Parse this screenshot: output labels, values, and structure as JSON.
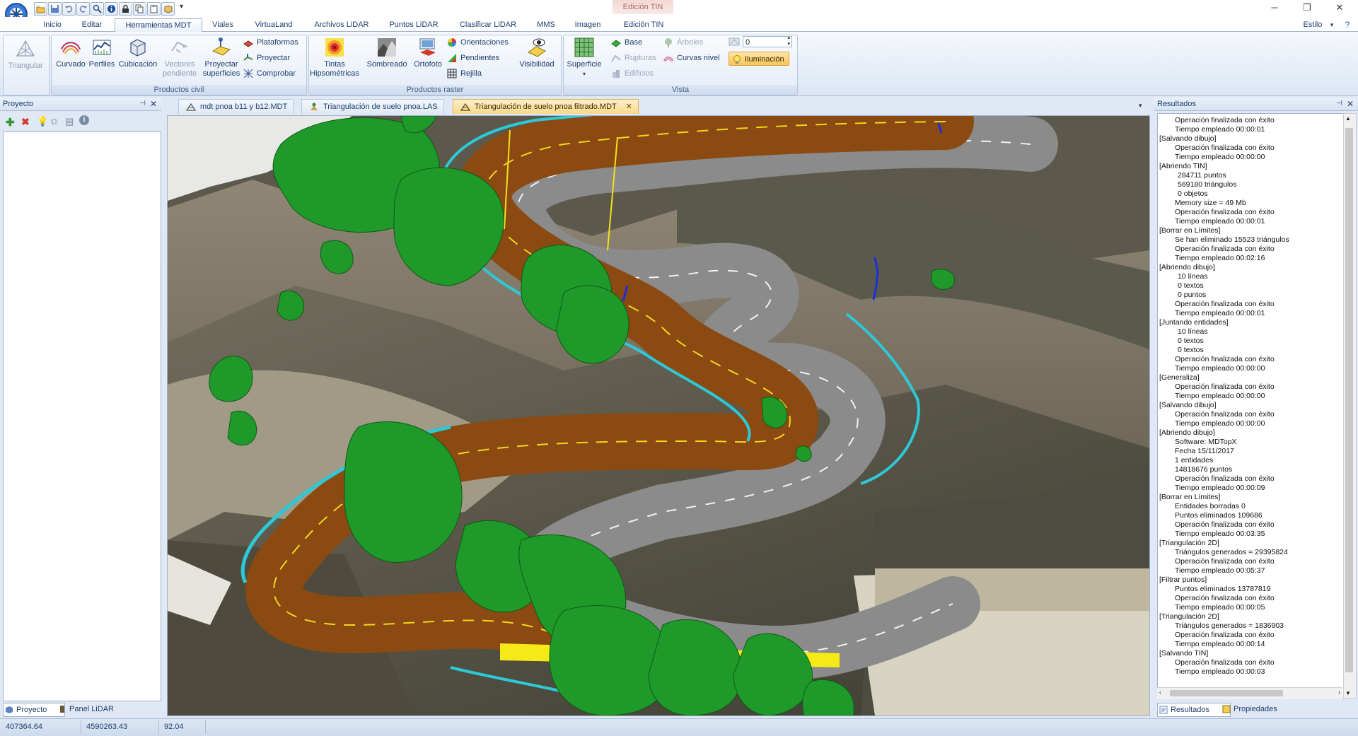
{
  "title_bar": {
    "context_tab_header": "Edición TIN",
    "window_controls": [
      "minimize",
      "restore",
      "close"
    ]
  },
  "ribbon": {
    "tabs": [
      {
        "label": "Inicio"
      },
      {
        "label": "Editar"
      },
      {
        "label": "Herramientas MDT",
        "active": true
      },
      {
        "label": "Viales"
      },
      {
        "label": "VirtuaLand"
      },
      {
        "label": "Archivos LiDAR"
      },
      {
        "label": "Puntos LiDAR"
      },
      {
        "label": "Clasificar LiDAR"
      },
      {
        "label": "MMS"
      },
      {
        "label": "Imagen"
      },
      {
        "label": "Edición TIN"
      }
    ],
    "style_label": "Estilo",
    "groups": {
      "triangular": {
        "button": "Triangular"
      },
      "productos_civil": {
        "label": "Productos civil",
        "buttons": [
          "Curvado",
          "Perfiles",
          "Cubicación",
          "Vectores pendiente",
          "Proyectar superficies"
        ],
        "small": [
          "Plataformas",
          "Proyectar",
          "Comprobar"
        ]
      },
      "productos_raster": {
        "label": "Productos raster",
        "buttons": [
          "Tintas Hipsométricas",
          "Sombreado",
          "Ortofoto",
          "Visibilidad"
        ],
        "small": [
          "Orientaciones",
          "Pendientes",
          "Rejilla"
        ]
      },
      "vista": {
        "label": "Vista",
        "superficie": "Superficie",
        "small": [
          "Base",
          "Rupturas",
          "Edificios",
          "Árboles",
          "Curvas nivel"
        ],
        "spin_value": "0",
        "iluminacion": "Iluminación"
      }
    }
  },
  "left_panel": {
    "title": "Proyecto",
    "bottom_tabs": [
      "Proyecto",
      "Panel LiDAR"
    ]
  },
  "documents": {
    "tabs": [
      {
        "label": "mdt pnoa b11 y b12.MDT"
      },
      {
        "label": "Triangulación de suelo pnoa.LAS"
      },
      {
        "label": "Triangulación de suelo pnoa filtrado.MDT",
        "active": true
      }
    ]
  },
  "results_panel": {
    "title": "Resultados",
    "bottom_tabs": [
      "Resultados",
      "Propiedades"
    ],
    "log": [
      {
        "t": "Operación finalizada con éxito",
        "lvl": 1
      },
      {
        "t": "Tiempo empleado 00:00:01",
        "lvl": 1
      },
      {
        "t": "[Salvando dibujo]",
        "lvl": 0
      },
      {
        "t": "Operación finalizada con éxito",
        "lvl": 1
      },
      {
        "t": "Tiempo empleado 00:00:00",
        "lvl": 1
      },
      {
        "t": "[Abriendo TIN]",
        "lvl": 0
      },
      {
        "t": "284711 puntos",
        "lvl": 2
      },
      {
        "t": "569180 triángulos",
        "lvl": 2
      },
      {
        "t": "0 objetos",
        "lvl": 2
      },
      {
        "t": "Memory size = 49 Mb",
        "lvl": 1
      },
      {
        "t": "Operación finalizada con éxito",
        "lvl": 1
      },
      {
        "t": "Tiempo empleado 00:00:01",
        "lvl": 1
      },
      {
        "t": "[Borrar en Límites]",
        "lvl": 0
      },
      {
        "t": "Se han eliminado 15523 triángulos",
        "lvl": 1
      },
      {
        "t": "Operación finalizada con éxito",
        "lvl": 1
      },
      {
        "t": "Tiempo empleado 00:02:16",
        "lvl": 1
      },
      {
        "t": "[Abriendo dibujo]",
        "lvl": 0
      },
      {
        "t": "10 líneas",
        "lvl": 2
      },
      {
        "t": "0 textos",
        "lvl": 2
      },
      {
        "t": "0 puntos",
        "lvl": 2
      },
      {
        "t": "Operación finalizada con éxito",
        "lvl": 1
      },
      {
        "t": "Tiempo empleado 00:00:01",
        "lvl": 1
      },
      {
        "t": "[Juntando entidades]",
        "lvl": 0
      },
      {
        "t": "10 líneas",
        "lvl": 2
      },
      {
        "t": "0 textos",
        "lvl": 2
      },
      {
        "t": "0 textos",
        "lvl": 2
      },
      {
        "t": "Operación finalizada con éxito",
        "lvl": 1
      },
      {
        "t": "Tiempo empleado 00:00:00",
        "lvl": 1
      },
      {
        "t": "[Generaliza]",
        "lvl": 0
      },
      {
        "t": "Operación finalizada con éxito",
        "lvl": 1
      },
      {
        "t": "Tiempo empleado 00:00:00",
        "lvl": 1
      },
      {
        "t": "[Salvando dibujo]",
        "lvl": 0
      },
      {
        "t": "Operación finalizada con éxito",
        "lvl": 1
      },
      {
        "t": "Tiempo empleado 00:00:00",
        "lvl": 1
      },
      {
        "t": "[Abriendo dibujo]",
        "lvl": 0
      },
      {
        "t": "Software: MDTopX",
        "lvl": 1
      },
      {
        "t": "Fecha 15/11/2017",
        "lvl": 1
      },
      {
        "t": "1 entidades",
        "lvl": 1
      },
      {
        "t": "14818676 puntos",
        "lvl": 1
      },
      {
        "t": "Operación finalizada con éxito",
        "lvl": 1
      },
      {
        "t": "Tiempo empleado 00:00:09",
        "lvl": 1
      },
      {
        "t": "[Borrar en Límites]",
        "lvl": 0
      },
      {
        "t": "Entidades borradas 0",
        "lvl": 1
      },
      {
        "t": "Puntos eliminados 109686",
        "lvl": 1
      },
      {
        "t": "Operación finalizada con éxito",
        "lvl": 1
      },
      {
        "t": "Tiempo empleado 00:03:35",
        "lvl": 1
      },
      {
        "t": "[Triangulación 2D]",
        "lvl": 0
      },
      {
        "t": "Triángulos generados = 29395824",
        "lvl": 1
      },
      {
        "t": "Operación finalizada con éxito",
        "lvl": 1
      },
      {
        "t": "Tiempo empleado 00:05:37",
        "lvl": 1
      },
      {
        "t": "[Filtrar puntos]",
        "lvl": 0
      },
      {
        "t": "Puntos eliminados 13787819",
        "lvl": 1
      },
      {
        "t": "Operación finalizada con éxito",
        "lvl": 1
      },
      {
        "t": "Tiempo empleado 00:00:05",
        "lvl": 1
      },
      {
        "t": "[Triangulación 2D]",
        "lvl": 0
      },
      {
        "t": "Triángulos generados = 1836903",
        "lvl": 1
      },
      {
        "t": "Operación finalizada con éxito",
        "lvl": 1
      },
      {
        "t": "Tiempo empleado 00:00:14",
        "lvl": 1
      },
      {
        "t": "[Salvando TIN]",
        "lvl": 0
      },
      {
        "t": "Operación finalizada con éxito",
        "lvl": 1
      },
      {
        "t": "Tiempo empleado 00:00:03",
        "lvl": 1
      }
    ]
  },
  "status_bar": {
    "x": "407364.64",
    "y": "4590263.43",
    "z": "92.04"
  },
  "colors": {
    "road_asphalt": "#8e8e8e",
    "road_dirt": "#8a4a12",
    "vegetation": "#1f9a2a",
    "guardrail": "#2ec9d6",
    "terrain": "#6a6253",
    "accent_active_tab": "#f8d88a"
  }
}
